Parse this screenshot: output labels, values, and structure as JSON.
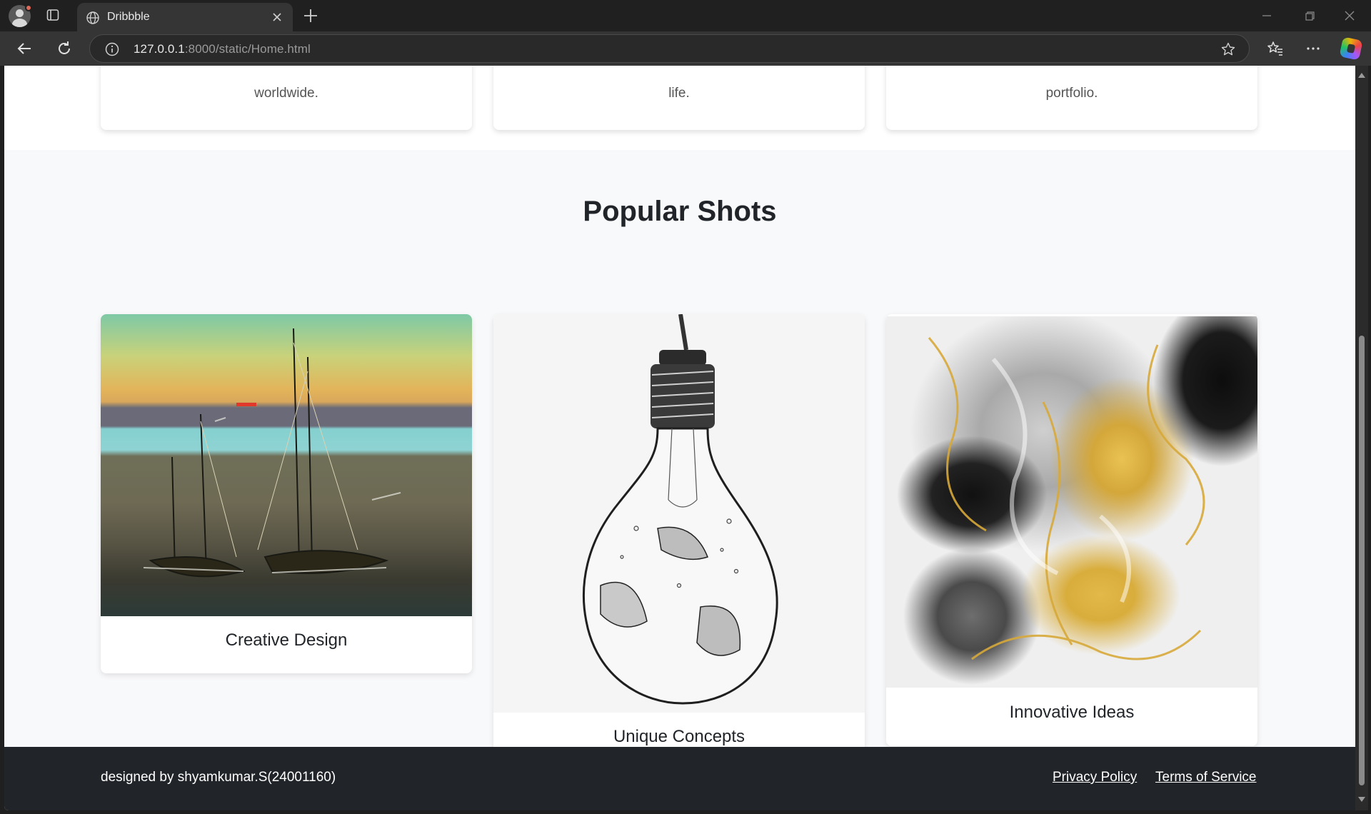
{
  "browser": {
    "tab_title": "Dribbble",
    "url_host": "127.0.0.1",
    "url_rest": ":8000/static/Home.html"
  },
  "features": [
    {
      "text": "worldwide."
    },
    {
      "text": "life."
    },
    {
      "text": "portfolio."
    }
  ],
  "popular": {
    "heading": "Popular Shots",
    "shots": [
      {
        "caption": "Creative Design"
      },
      {
        "caption": "Unique Concepts"
      },
      {
        "caption": "Innovative Ideas"
      }
    ]
  },
  "footer": {
    "credit": "designed by shyamkumar.S(24001160)",
    "privacy": "Privacy Policy",
    "terms": "Terms of Service"
  }
}
